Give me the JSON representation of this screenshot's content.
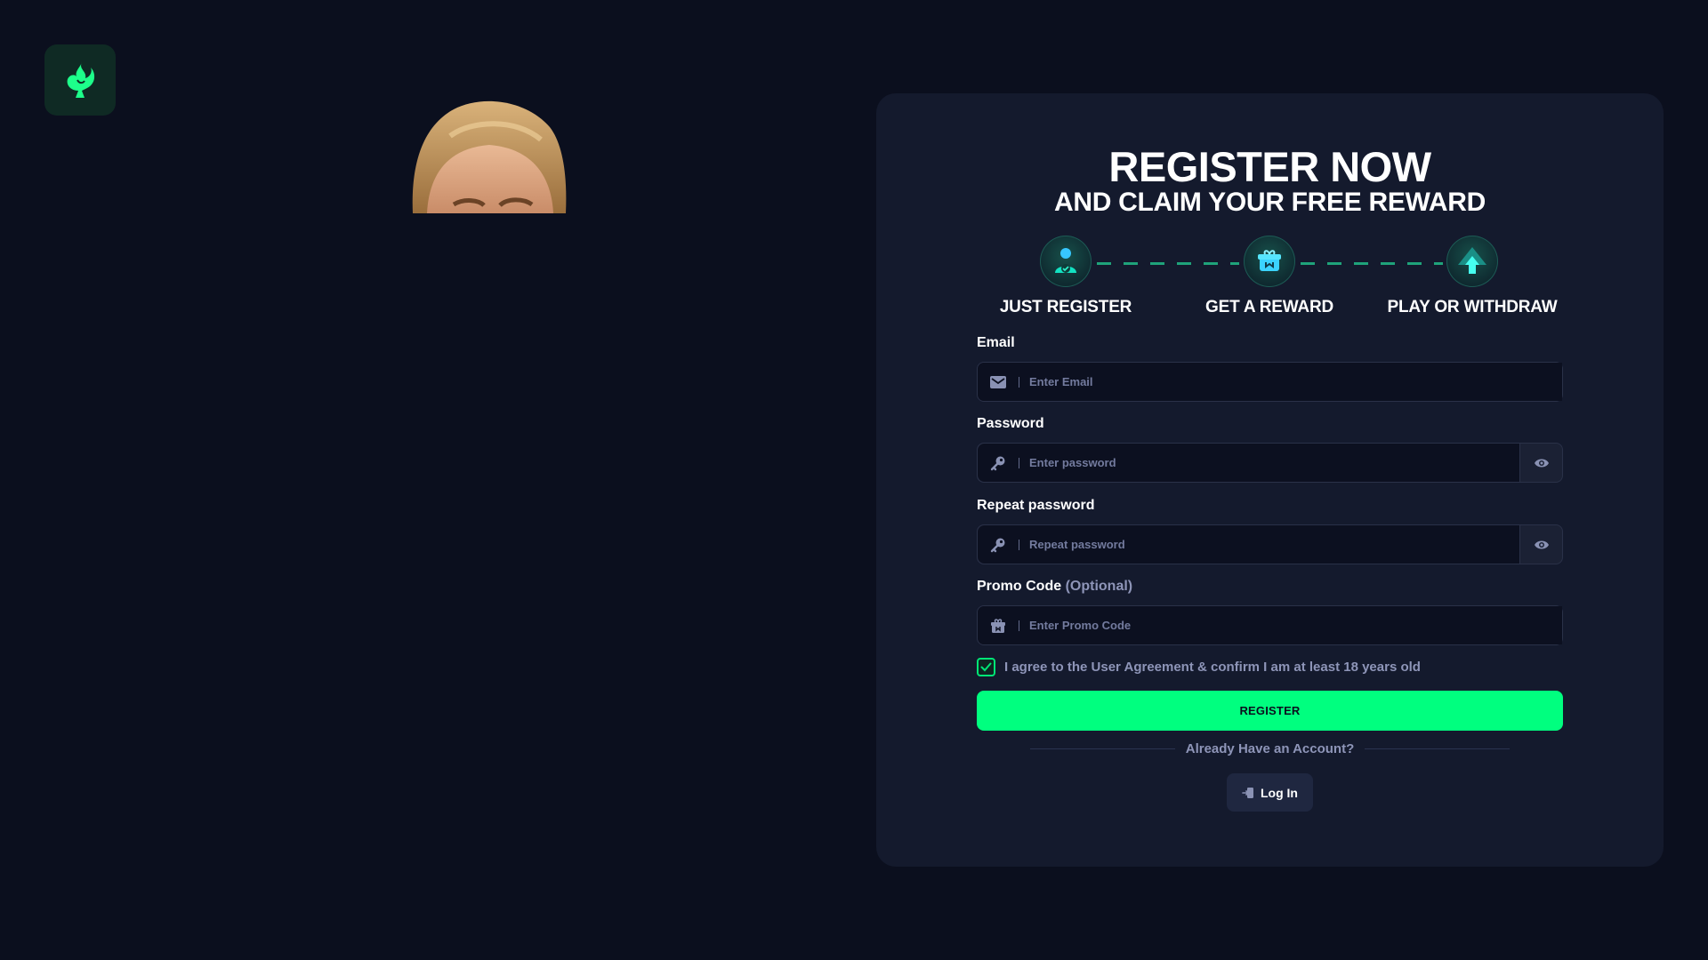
{
  "brand": {
    "logo_icon": "spade-flame-icon",
    "accent": "#00ff7f"
  },
  "register": {
    "title": "REGISTER NOW",
    "subtitle": "AND CLAIM YOUR FREE REWARD",
    "steps": [
      {
        "label": "JUST REGISTER",
        "icon": "user-check-icon"
      },
      {
        "label": "GET A REWARD",
        "icon": "gift-box-icon"
      },
      {
        "label": "PLAY OR WITHDRAW",
        "icon": "arrow-up-icon"
      }
    ],
    "email": {
      "label": "Email",
      "placeholder": "Enter Email",
      "value": "",
      "icon": "envelope-icon"
    },
    "password": {
      "label": "Password",
      "placeholder": "Enter password",
      "value": "",
      "icon": "key-icon"
    },
    "repeat_password": {
      "label": "Repeat password",
      "placeholder": "Repeat password",
      "value": "",
      "icon": "key-icon"
    },
    "promo": {
      "label": "Promo Code",
      "optional": "(Optional)",
      "placeholder": "Enter Promo Code",
      "value": "",
      "icon": "gift-icon"
    },
    "agree": {
      "checked": true,
      "text": "I agree to the User Agreement & confirm I am at least 18 years old"
    },
    "register_button": "REGISTER",
    "already_account": "Already Have an Account?",
    "login_button": "Log In"
  }
}
